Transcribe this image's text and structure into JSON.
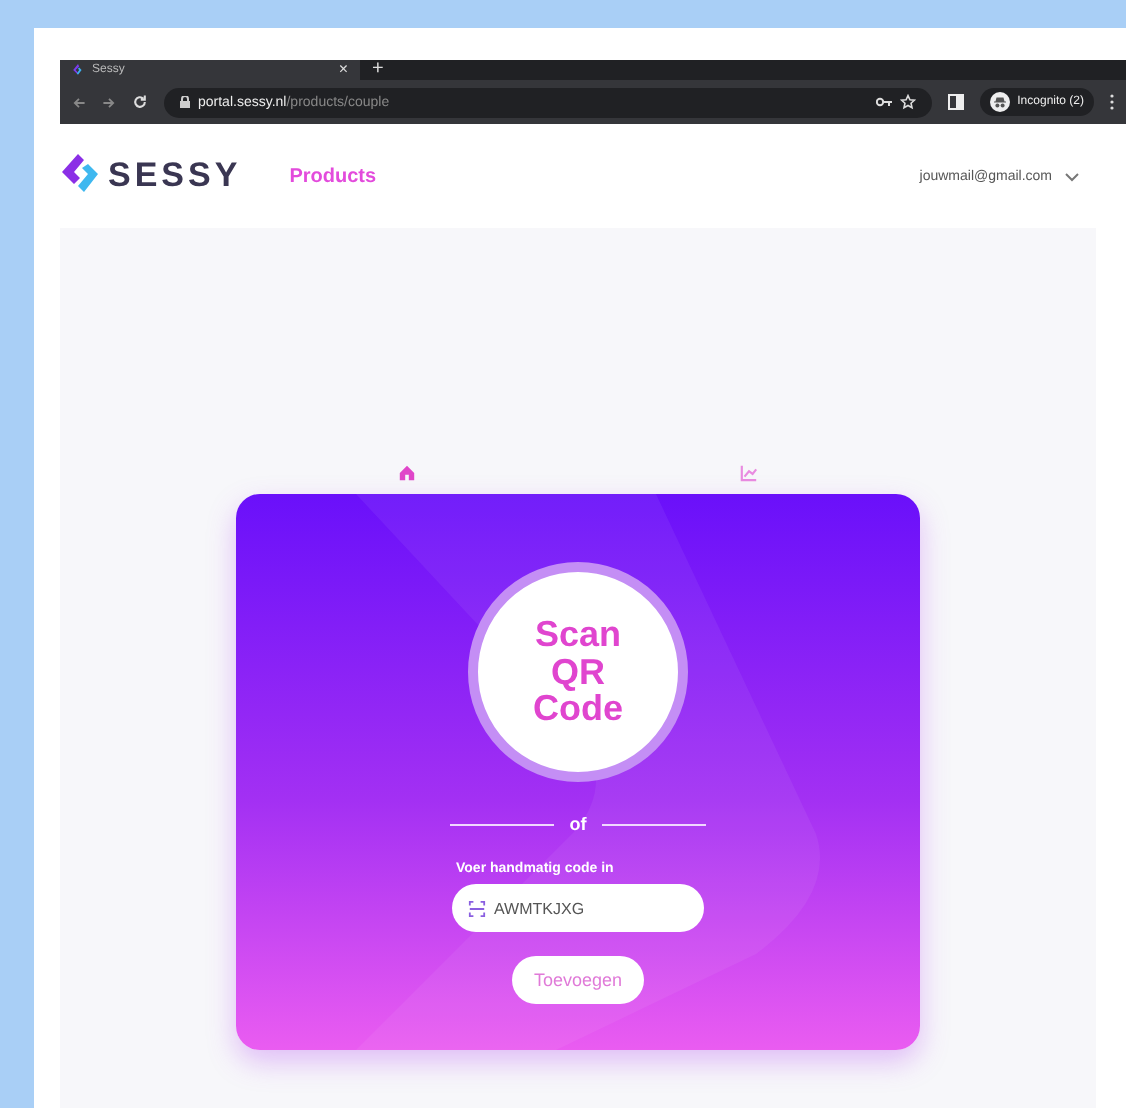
{
  "browser": {
    "tab_title": "Sessy",
    "tab_close": "×",
    "new_tab": "+",
    "url_host": "portal.sessy.nl",
    "url_path": "/products/couple",
    "profile": "Incognito (2)"
  },
  "header": {
    "logo": "SESSY",
    "nav": [
      {
        "label": "Products",
        "selected": true
      }
    ],
    "account": "jouwmail@gmail.com"
  },
  "view_tabs": [
    {
      "kind": "home",
      "selected": true
    },
    {
      "kind": "chart",
      "selected": false
    }
  ],
  "card": {
    "scan_title": "Scan QR Code",
    "divider": "of",
    "code_label": "Voer handmatig code in",
    "code_value": "AWMTKJXG",
    "submit": "Toevoegen"
  }
}
